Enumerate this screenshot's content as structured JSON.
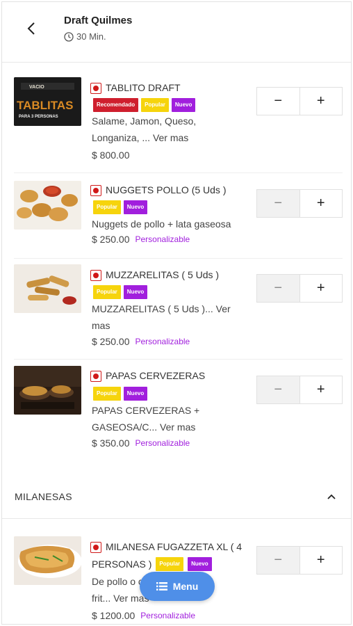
{
  "header": {
    "store_name": "Draft Quilmes",
    "eta": "30 Min."
  },
  "section": {
    "title": "MILANESAS"
  },
  "items": [
    {
      "name": "TABLITO DRAFT",
      "badges": [
        "Recomendado",
        "Popular",
        "Nuevo"
      ],
      "desc_line1": "Salame, Jamon, Queso,",
      "desc_line2": "Longaniza, ... Ver mas",
      "price": "$ 800.00",
      "custom": "",
      "thumb_text_top": "VACIO",
      "thumb_text_main": "TABLITAS",
      "thumb_text_sub": "PARA 3 PERSONAS"
    },
    {
      "name": "NUGGETS POLLO (5 Uds )",
      "badges": [
        "Popular",
        "Nuevo"
      ],
      "desc_line1": "Nuggets de pollo + lata gaseosa",
      "desc_line2": "",
      "price": "$ 250.00",
      "custom": "Personalizable"
    },
    {
      "name": "MUZZARELITAS ( 5 Uds )",
      "badges": [
        "Popular",
        "Nuevo"
      ],
      "desc_line1": "MUZZARELITAS ( 5 Uds )... Ver",
      "desc_line2": "mas",
      "price": "$ 250.00",
      "custom": "Personalizable"
    },
    {
      "name": "PAPAS CERVEZERAS",
      "badges": [
        "Popular",
        "Nuevo"
      ],
      "desc_line1": "PAPAS CERVEZERAS +",
      "desc_line2": "GASEOSA/C... Ver mas",
      "price": "$ 350.00",
      "custom": "Personalizable"
    },
    {
      "name": "MILANESA FUGAZZETA XL ( 4",
      "name_line2": "PERSONAS )",
      "badges": [
        "Popular",
        "Nuevo"
      ],
      "desc_line1": "De pollo o carne + papas",
      "desc_line2": "frit... Ver mas",
      "price": "$ 1200.00",
      "custom": "Personalizable"
    }
  ],
  "qty": {
    "minus": "−",
    "plus": "+"
  },
  "fab": {
    "label": "Menu"
  },
  "colors": {
    "recomendado": "#cf1f2e",
    "popular": "#f6d40c",
    "nuevo": "#a11fdd",
    "fab": "#4f8fe8",
    "veg_mark": "#d01818"
  }
}
